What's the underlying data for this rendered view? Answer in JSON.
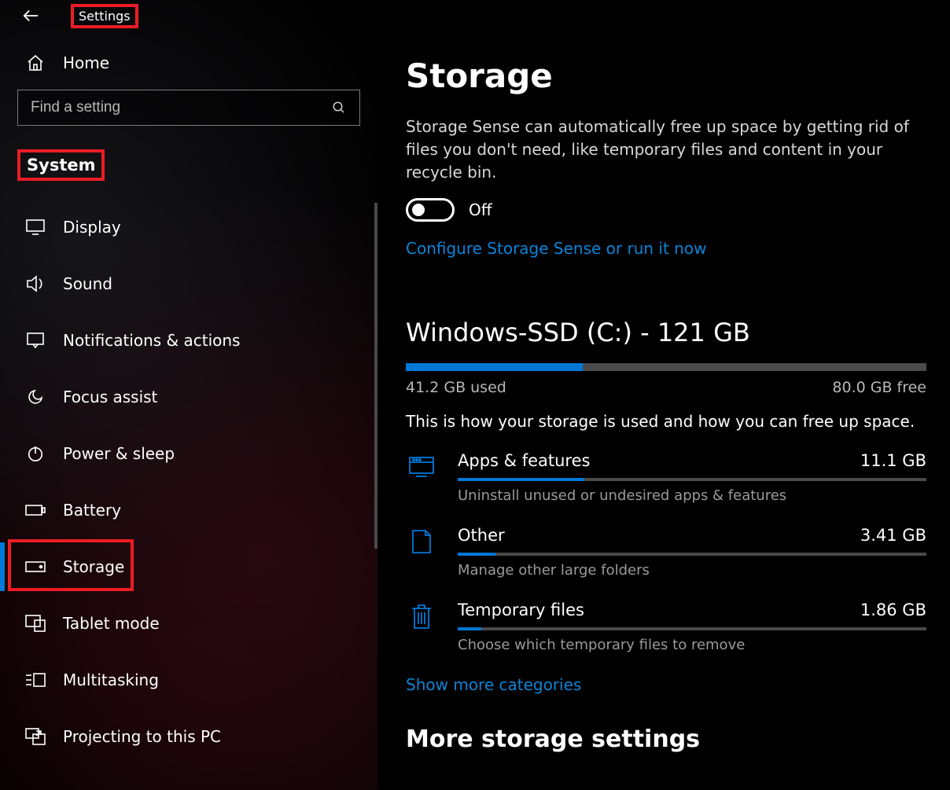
{
  "app_title": "Settings",
  "home_label": "Home",
  "search_placeholder": "Find a setting",
  "section_label": "System",
  "nav": [
    {
      "id": "display",
      "label": "Display"
    },
    {
      "id": "sound",
      "label": "Sound"
    },
    {
      "id": "notifications",
      "label": "Notifications & actions"
    },
    {
      "id": "focus-assist",
      "label": "Focus assist"
    },
    {
      "id": "power-sleep",
      "label": "Power & sleep"
    },
    {
      "id": "battery",
      "label": "Battery"
    },
    {
      "id": "storage",
      "label": "Storage",
      "active": true
    },
    {
      "id": "tablet-mode",
      "label": "Tablet mode"
    },
    {
      "id": "multitasking",
      "label": "Multitasking"
    },
    {
      "id": "projecting",
      "label": "Projecting to this PC"
    }
  ],
  "main": {
    "title": "Storage",
    "sense_desc": "Storage Sense can automatically free up space by getting rid of files you don't need, like temporary files and content in your recycle bin.",
    "toggle_state": "Off",
    "configure_link": "Configure Storage Sense or run it now",
    "drive": {
      "title": "Windows-SSD (C:) - 121 GB",
      "used_label": "41.2 GB used",
      "free_label": "80.0 GB free",
      "used_pct": 34,
      "hint": "This is how your storage is used and how you can free up space."
    },
    "categories": [
      {
        "id": "apps",
        "label": "Apps & features",
        "size": "11.1 GB",
        "sub": "Uninstall unused or undesired apps & features",
        "pct": 27
      },
      {
        "id": "other",
        "label": "Other",
        "size": "3.41 GB",
        "sub": "Manage other large folders",
        "pct": 8
      },
      {
        "id": "temp",
        "label": "Temporary files",
        "size": "1.86 GB",
        "sub": "Choose which temporary files to remove",
        "pct": 5
      }
    ],
    "show_more": "Show more categories",
    "section2_title": "More storage settings"
  },
  "colors": {
    "accent": "#0078d7",
    "link": "#0a84d8",
    "highlight_box": "#ed1c24"
  }
}
